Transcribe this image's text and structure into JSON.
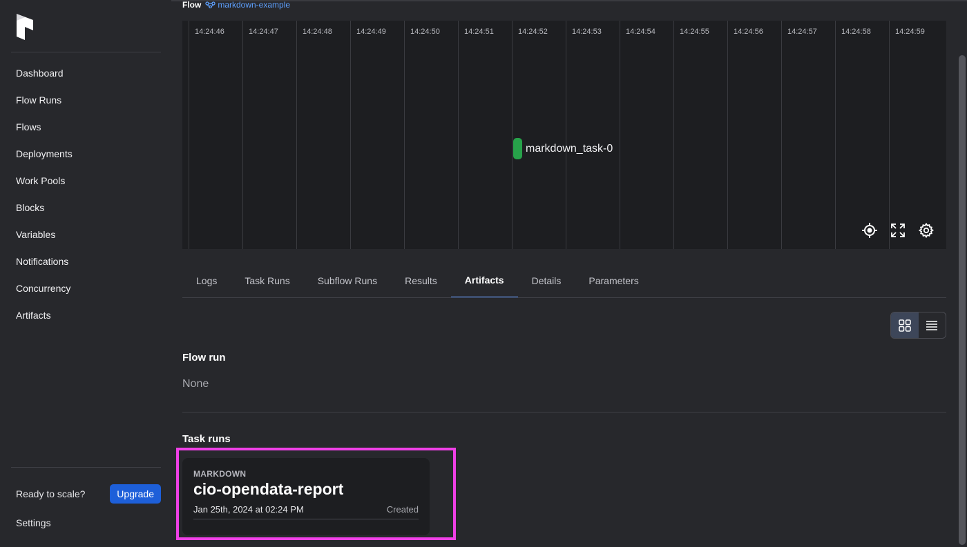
{
  "sidebar": {
    "items": [
      {
        "label": "Dashboard"
      },
      {
        "label": "Flow Runs"
      },
      {
        "label": "Flows"
      },
      {
        "label": "Deployments"
      },
      {
        "label": "Work Pools"
      },
      {
        "label": "Blocks"
      },
      {
        "label": "Variables"
      },
      {
        "label": "Notifications"
      },
      {
        "label": "Concurrency"
      },
      {
        "label": "Artifacts"
      }
    ],
    "ready_text": "Ready to scale?",
    "upgrade_label": "Upgrade",
    "settings_label": "Settings"
  },
  "flow": {
    "label": "Flow",
    "name": "markdown-example"
  },
  "timeline": {
    "ticks": [
      "14:24:46",
      "14:24:47",
      "14:24:48",
      "14:24:49",
      "14:24:50",
      "14:24:51",
      "14:24:52",
      "14:24:53",
      "14:24:54",
      "14:24:55",
      "14:24:56",
      "14:24:57",
      "14:24:58",
      "14:24:59"
    ],
    "task_label": "markdown_task-0",
    "task_color": "#27a24a"
  },
  "tabs": [
    {
      "label": "Logs"
    },
    {
      "label": "Task Runs"
    },
    {
      "label": "Subflow Runs"
    },
    {
      "label": "Results"
    },
    {
      "label": "Artifacts",
      "active": true
    },
    {
      "label": "Details"
    },
    {
      "label": "Parameters"
    }
  ],
  "artifacts": {
    "flow_run_title": "Flow run",
    "flow_run_empty": "None",
    "task_runs_title": "Task runs",
    "card": {
      "kind": "MARKDOWN",
      "key": "cio-opendata-report",
      "date": "Jan 25th, 2024 at 02:24 PM",
      "status": "Created"
    }
  },
  "colors": {
    "highlight": "#ef40e6",
    "accent": "#1d5fd9",
    "link": "#5ea1ff"
  }
}
